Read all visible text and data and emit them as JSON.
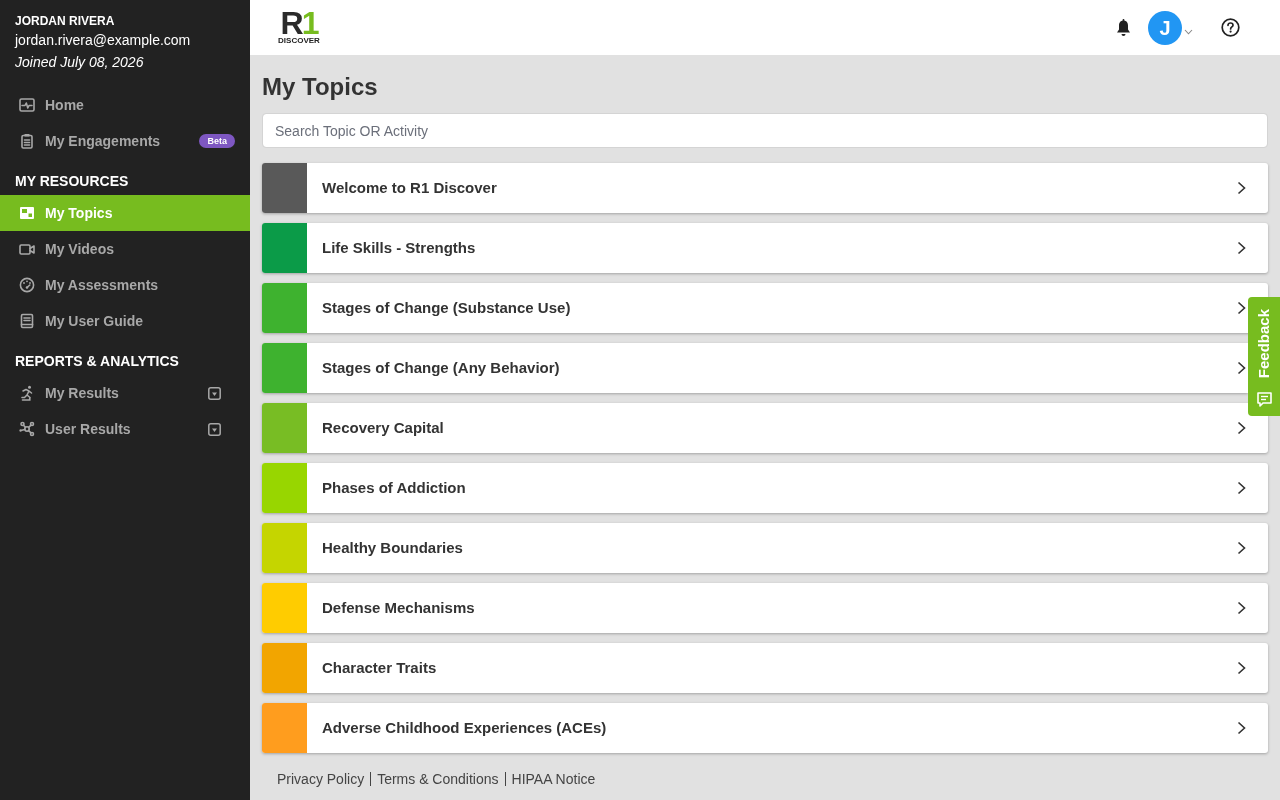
{
  "user": {
    "name": "JORDAN RIVERA",
    "email": "jordan.rivera@example.com",
    "joined": "Joined July 08, 2026"
  },
  "sidebar": {
    "sections": [
      {
        "items": [
          {
            "label": "Home",
            "selected": false
          },
          {
            "label": "My Engagements",
            "selected": false,
            "badge": "Beta"
          }
        ]
      },
      {
        "heading": "MY RESOURCES",
        "items": [
          {
            "label": "My Topics",
            "selected": true
          },
          {
            "label": "My Videos",
            "selected": false
          },
          {
            "label": "My Assessments",
            "selected": false
          },
          {
            "label": "My User Guide",
            "selected": false
          }
        ]
      },
      {
        "heading": "REPORTS & ANALYTICS",
        "items": [
          {
            "label": "My Results",
            "selected": false,
            "expanded": false
          },
          {
            "label": "User Results",
            "selected": false,
            "expanded": false
          }
        ]
      }
    ]
  },
  "header": {
    "logo": {
      "letter": "R",
      "digit": "1",
      "tagline": "DISCOVER"
    },
    "avatar_initial": "J"
  },
  "page": {
    "title": "My Topics",
    "search": {
      "placeholder": "Search Topic OR Activity"
    },
    "topics": [
      {
        "title": "Welcome to R1 Discover",
        "color": "#595959"
      },
      {
        "title": "Life Skills - Strengths",
        "color": "#0b9b48"
      },
      {
        "title": "Stages of Change (Substance Use)",
        "color": "#3eb22f"
      },
      {
        "title": "Stages of Change (Any Behavior)",
        "color": "#3eb22f"
      },
      {
        "title": "Recovery Capital",
        "color": "#78bd24"
      },
      {
        "title": "Phases of Addiction",
        "color": "#98d600"
      },
      {
        "title": "Healthy Boundaries",
        "color": "#c5d500"
      },
      {
        "title": "Defense Mechanisms",
        "color": "#ffcc00"
      },
      {
        "title": "Character Traits",
        "color": "#f2a500"
      },
      {
        "title": "Adverse Childhood Experiences (ACEs)",
        "color": "#ff9d1e"
      }
    ]
  },
  "footer_links": [
    "Privacy Policy",
    "Terms & Conditions",
    "HIPAA Notice"
  ],
  "feedback_tab": {
    "label": "Feedback"
  }
}
